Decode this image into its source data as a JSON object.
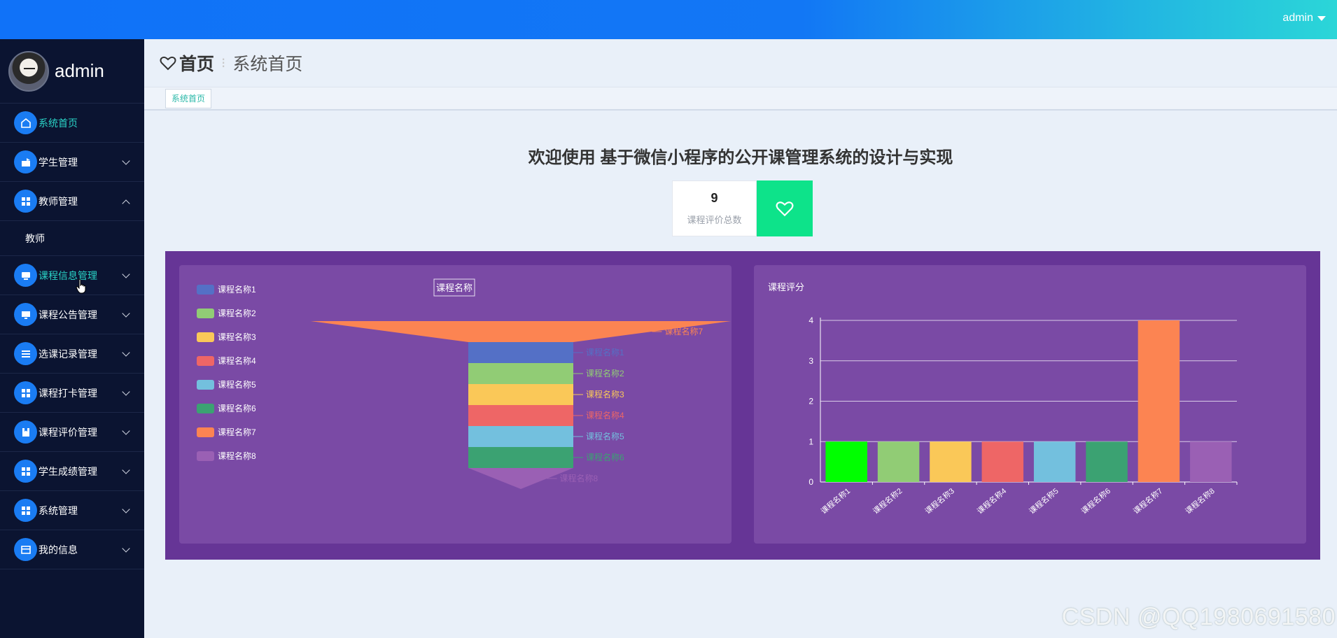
{
  "topbar": {
    "user": "admin"
  },
  "sidebar": {
    "profile_name": "admin",
    "items": [
      {
        "label": "系统首页",
        "icon": "home-icon"
      },
      {
        "label": "学生管理",
        "icon": "student-icon"
      },
      {
        "label": "教师管理",
        "icon": "grid-icon"
      },
      {
        "label": "教师",
        "icon": ""
      },
      {
        "label": "课程信息管理",
        "icon": "monitor-icon"
      },
      {
        "label": "课程公告管理",
        "icon": "monitor-icon"
      },
      {
        "label": "选课记录管理",
        "icon": "list-icon"
      },
      {
        "label": "课程打卡管理",
        "icon": "grid-icon"
      },
      {
        "label": "课程评价管理",
        "icon": "document-icon"
      },
      {
        "label": "学生成绩管理",
        "icon": "grid-icon"
      },
      {
        "label": "系统管理",
        "icon": "grid-icon"
      },
      {
        "label": "我的信息",
        "icon": "card-icon"
      }
    ]
  },
  "header": {
    "home": "首页",
    "current": "系统首页"
  },
  "tabs": [
    {
      "label": "系统首页"
    }
  ],
  "welcome": "欢迎使用 基于微信小程序的公开课管理系统的设计与实现",
  "stat": {
    "value": "9",
    "label": "课程评价总数"
  },
  "colors": {
    "topbar_start": "#1072f8",
    "topbar_end": "#2bd6d8",
    "sidebar_bg": "#0b1431",
    "accent_teal": "#2ad4c7",
    "stat_green": "#0de38a",
    "chart_bg": "#663596",
    "panel_bg": "#7a4aa5"
  },
  "chart_data": [
    {
      "type": "funnel",
      "title": "课程名称",
      "legend_position": "left",
      "categories": [
        "课程名称1",
        "课程名称2",
        "课程名称3",
        "课程名称4",
        "课程名称5",
        "课程名称6",
        "课程名称7",
        "课程名称8"
      ],
      "values": [
        1,
        1,
        1,
        1,
        1,
        1,
        4,
        1
      ],
      "colors": [
        "#5470c6",
        "#91cc75",
        "#fac858",
        "#ee6666",
        "#73c0de",
        "#3ba272",
        "#fc8452",
        "#9a60b4"
      ]
    },
    {
      "type": "bar",
      "title": "课程评分",
      "categories": [
        "课程名称1",
        "课程名称2",
        "课程名称3",
        "课程名称4",
        "课程名称5",
        "课程名称6",
        "课程名称7",
        "课程名称8"
      ],
      "values": [
        1,
        1,
        1,
        1,
        1,
        1,
        4,
        1
      ],
      "colors": [
        "#00ff00",
        "#91cc75",
        "#fac858",
        "#ee6666",
        "#73c0de",
        "#3ba272",
        "#fc8452",
        "#9a60b4"
      ],
      "ylim": [
        0,
        4
      ],
      "yticks": [
        "0",
        "1",
        "2",
        "3",
        "4"
      ],
      "grid": true
    }
  ],
  "watermark": "CSDN @QQ1980691580"
}
